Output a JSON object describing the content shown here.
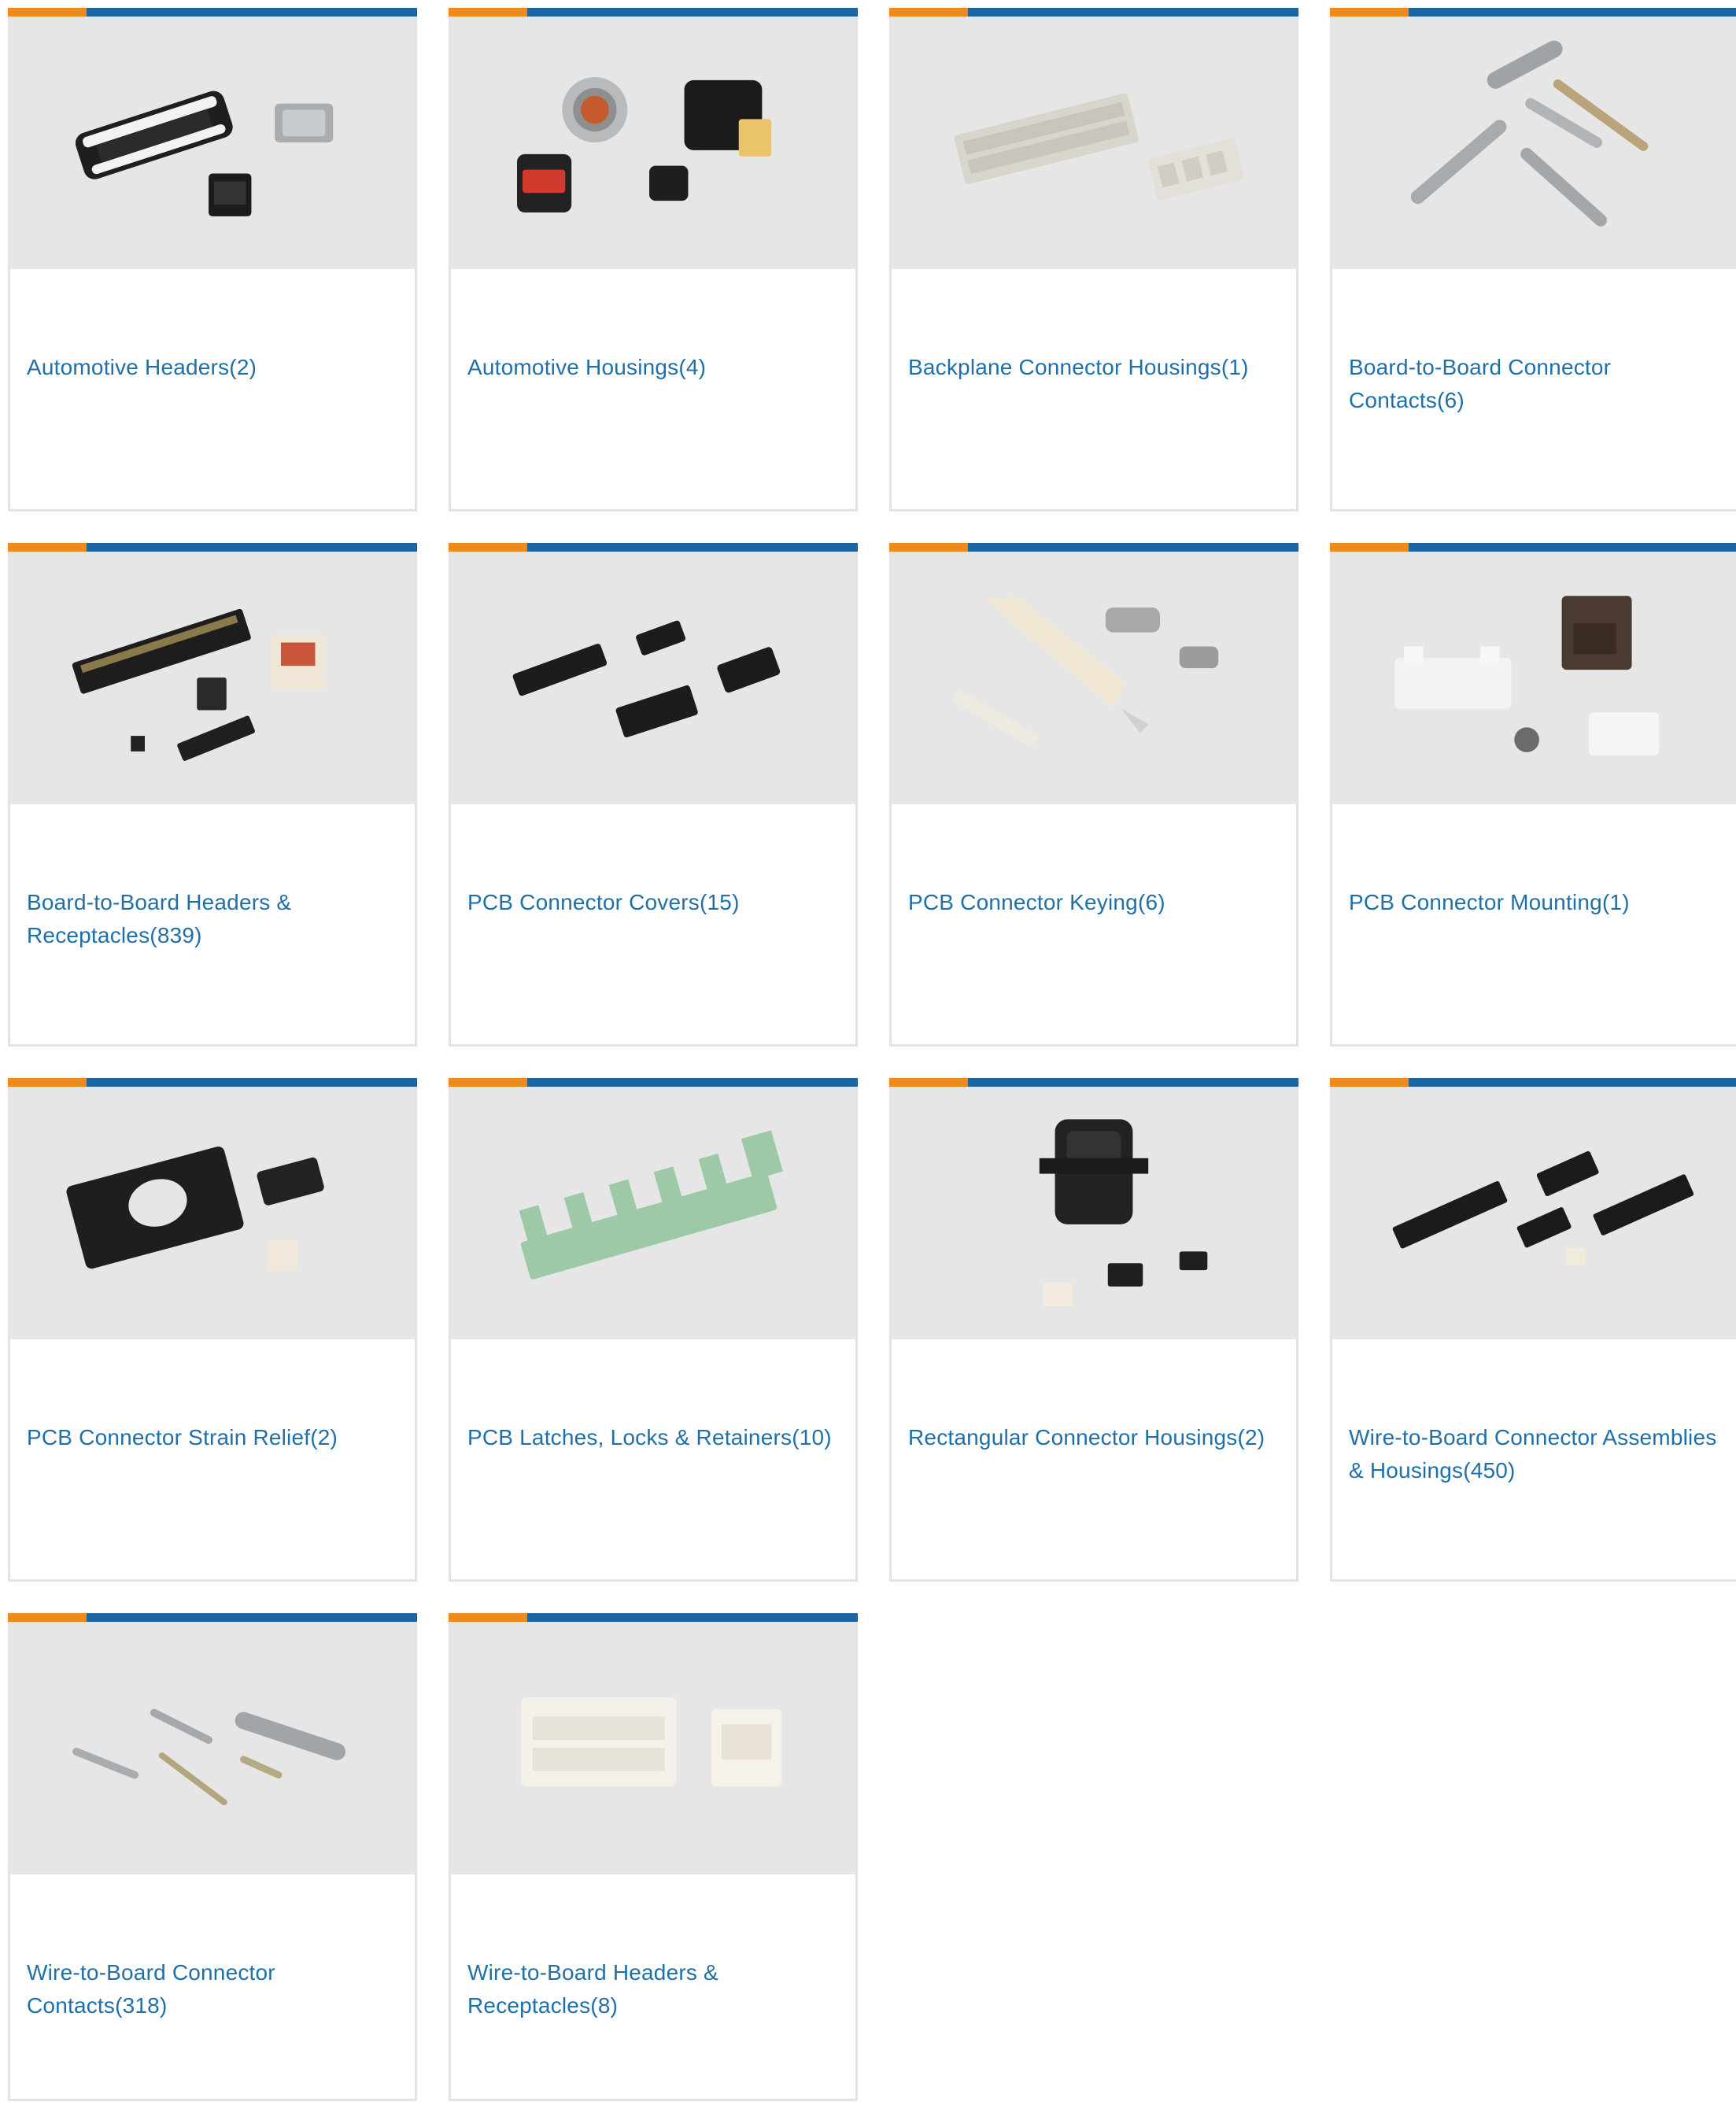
{
  "colors": {
    "accent_orange": "#ee8a1b",
    "accent_blue": "#1b64a1",
    "link": "#1f6fa8",
    "image_bg": "#e6e6e6",
    "card_border": "#e3e3e3"
  },
  "categories": [
    {
      "name": "Automotive Headers",
      "count": "(2)",
      "image": "automotive-headers-photo"
    },
    {
      "name": "Automotive Housings",
      "count": "(4)",
      "image": "automotive-housings-photo"
    },
    {
      "name": "Backplane Connector Housings",
      "count": "(1)",
      "image": "backplane-connector-housings-photo"
    },
    {
      "name": "Board-to-Board Connector Contacts",
      "count": "(6)",
      "image": "board-to-board-connector-contacts-photo"
    },
    {
      "name": "Board-to-Board Headers & Receptacles",
      "count": "(839)",
      "image": "board-to-board-headers-receptacles-photo"
    },
    {
      "name": "PCB Connector Covers",
      "count": "(15)",
      "image": "pcb-connector-covers-photo"
    },
    {
      "name": "PCB Connector Keying",
      "count": "(6)",
      "image": "pcb-connector-keying-photo"
    },
    {
      "name": "PCB Connector Mounting",
      "count": "(1)",
      "image": "pcb-connector-mounting-photo"
    },
    {
      "name": "PCB Connector Strain Relief",
      "count": "(2)",
      "image": "pcb-connector-strain-relief-photo"
    },
    {
      "name": "PCB Latches, Locks & Retainers",
      "count": "(10)",
      "image": "pcb-latches-locks-retainers-photo"
    },
    {
      "name": "Rectangular Connector Housings",
      "count": "(2)",
      "image": "rectangular-connector-housings-photo"
    },
    {
      "name": "Wire-to-Board Connector Assemblies & Housings",
      "count": "(450)",
      "image": "wire-to-board-connector-assemblies-housings-photo"
    },
    {
      "name": "Wire-to-Board Connector Contacts",
      "count": "(318)",
      "image": "wire-to-board-connector-contacts-photo"
    },
    {
      "name": "Wire-to-Board Headers & Receptacles",
      "count": "(8)",
      "image": "wire-to-board-headers-receptacles-photo"
    }
  ]
}
